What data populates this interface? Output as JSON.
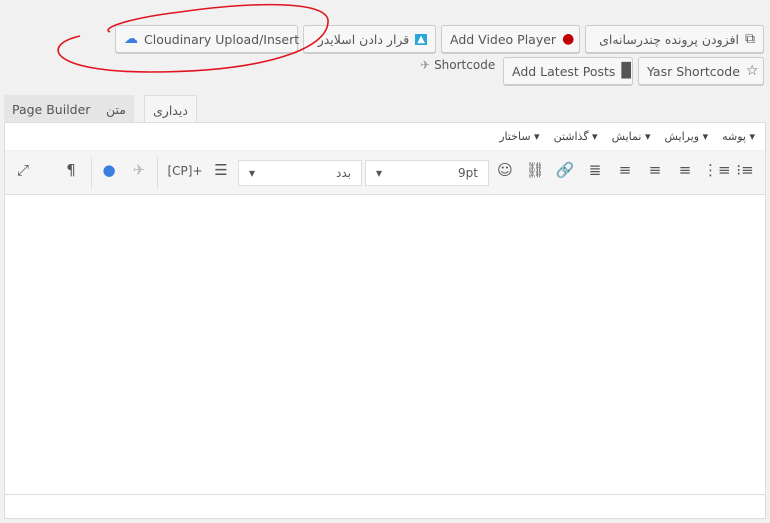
{
  "media_buttons": [
    {
      "label": "افزودن پرونده چندرسانه‌ای",
      "icon": "media-icon"
    },
    {
      "label": "Add Video Player",
      "icon": "play-icon"
    },
    {
      "label": "قرار دادن اسلایدر",
      "icon": "slider-icon"
    },
    {
      "label": "Cloudinary Upload/Insert",
      "icon": "cloud-icon"
    },
    {
      "label": "Yasr Shortcode",
      "icon": "star-icon"
    },
    {
      "label": "Add Latest Posts",
      "icon": "posts-icon"
    },
    {
      "label": "Shortcode",
      "icon": "shortcode-icon"
    }
  ],
  "tabs": [
    {
      "label": "دیداری",
      "active": true
    },
    {
      "label": "متن"
    },
    {
      "label": "Page Builder"
    }
  ],
  "menu": [
    "پوشه",
    "ویرایش",
    "نمایش",
    "گذاشتن",
    "ساختار"
  ],
  "toolbar": {
    "font_size": "9pt",
    "font_family": "بدد",
    "cp_label": "[CP]+"
  },
  "colors": {
    "annotation": "#e0141e",
    "quote_blue": "#3b7de0",
    "play_red": "#c00000"
  }
}
